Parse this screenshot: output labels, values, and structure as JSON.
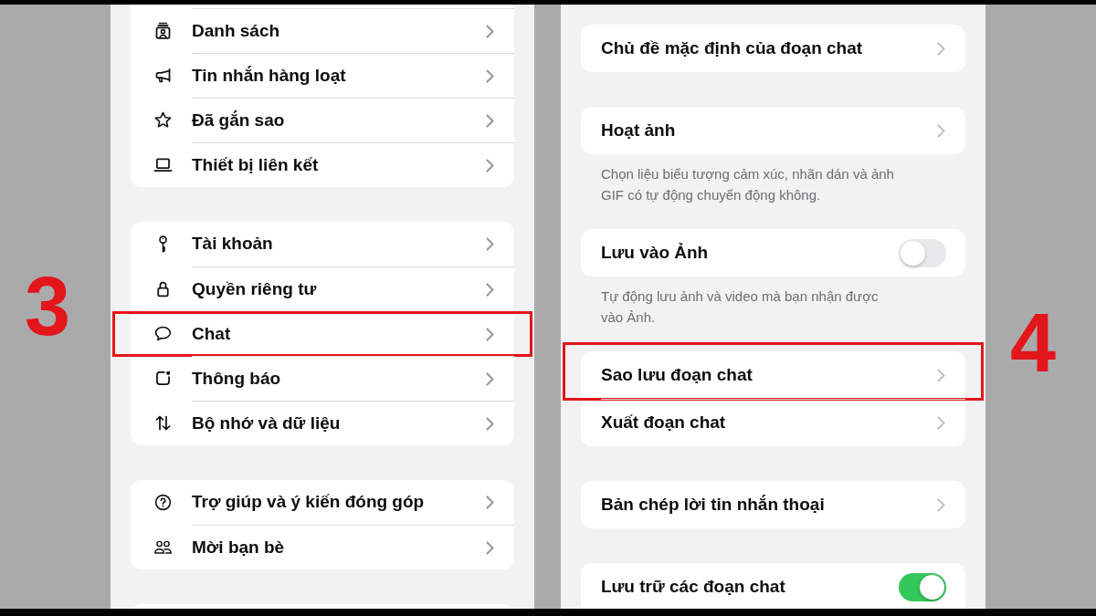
{
  "screens": [
    {
      "step_label": "3",
      "more_below": true,
      "groups": [
        {
          "cut_off_top": true,
          "items": [
            {
              "kind": "link",
              "label": "Danh sách",
              "highlighted": false
            },
            {
              "kind": "link",
              "label": "Tin nhắn hàng loạt",
              "highlighted": false
            },
            {
              "kind": "link",
              "label": "Đã gắn sao",
              "highlighted": false
            },
            {
              "kind": "link",
              "label": "Thiết bị liên kết",
              "highlighted": false
            }
          ]
        },
        {
          "items": [
            {
              "kind": "link",
              "label": "Tài khoản",
              "highlighted": false
            },
            {
              "kind": "link",
              "label": "Quyền riêng tư",
              "highlighted": false
            },
            {
              "kind": "link",
              "label": "Chat",
              "highlighted": true
            },
            {
              "kind": "link",
              "label": "Thông báo",
              "highlighted": false
            },
            {
              "kind": "link",
              "label": "Bộ nhớ và dữ liệu",
              "highlighted": false
            }
          ]
        },
        {
          "items": [
            {
              "kind": "link",
              "label": "Trợ giúp và ý kiến đóng góp",
              "highlighted": false
            },
            {
              "kind": "link",
              "label": "Mời bạn bè",
              "highlighted": false
            }
          ]
        }
      ]
    },
    {
      "step_label": "4",
      "more_below": false,
      "groups": [
        {
          "items": [
            {
              "kind": "link",
              "label": "Chủ đề mặc định của đoạn chat",
              "highlighted": false
            }
          ]
        },
        {
          "items": [
            {
              "kind": "link",
              "label": "Hoạt ảnh",
              "highlighted": false
            }
          ],
          "footer": "Chọn liệu biểu tượng cảm xúc, nhãn dán và ảnh GIF có tự động chuyển động không."
        },
        {
          "items": [
            {
              "kind": "toggle",
              "label": "Lưu vào Ảnh",
              "on": false,
              "highlighted": false
            }
          ],
          "footer": "Tự động lưu ảnh và video mà bạn nhận được vào Ảnh."
        },
        {
          "items": [
            {
              "kind": "link",
              "label": "Sao lưu đoạn chat",
              "highlighted": true
            },
            {
              "kind": "link",
              "label": "Xuất đoạn chat",
              "highlighted": false
            }
          ]
        },
        {
          "items": [
            {
              "kind": "link",
              "label": "Bản chép lời tin nhắn thoại",
              "highlighted": false
            }
          ]
        },
        {
          "cut_off_bottom": true,
          "items": [
            {
              "kind": "toggle",
              "label": "Lưu trữ các đoạn chat",
              "on": true,
              "highlighted": false
            }
          ]
        }
      ]
    }
  ]
}
